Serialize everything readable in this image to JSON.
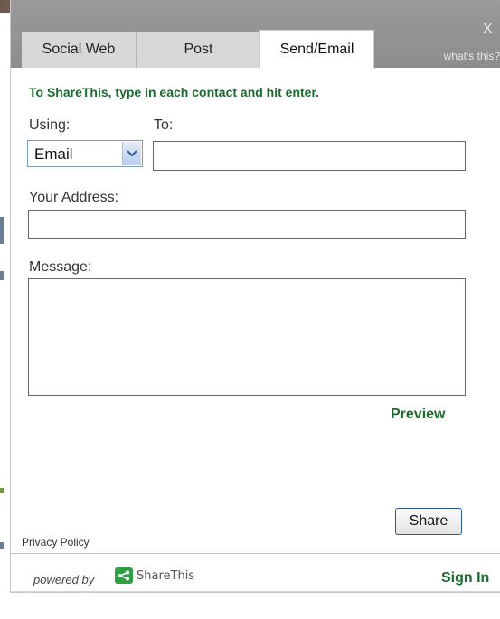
{
  "tabs": [
    {
      "label": "Social Web",
      "active": false
    },
    {
      "label": "Post",
      "active": false
    },
    {
      "label": "Send/Email",
      "active": true
    }
  ],
  "header": {
    "close_label": "X",
    "whats_this": "what's this?"
  },
  "instruction": "To ShareThis, type in each contact and hit enter.",
  "form": {
    "using_label": "Using:",
    "using_value": "Email",
    "to_label": "To:",
    "to_value": "",
    "address_label": "Your Address:",
    "address_value": "",
    "message_label": "Message:",
    "message_value": ""
  },
  "actions": {
    "preview": "Preview",
    "share": "Share"
  },
  "footer": {
    "privacy": "Privacy Policy",
    "powered_by": "powered by",
    "brand": "ShareThis",
    "sign_in": "Sign In"
  },
  "colors": {
    "accent_green": "#1a6b2e",
    "header_gray": "#8d8d8d",
    "logo_green": "#2f9f44"
  }
}
